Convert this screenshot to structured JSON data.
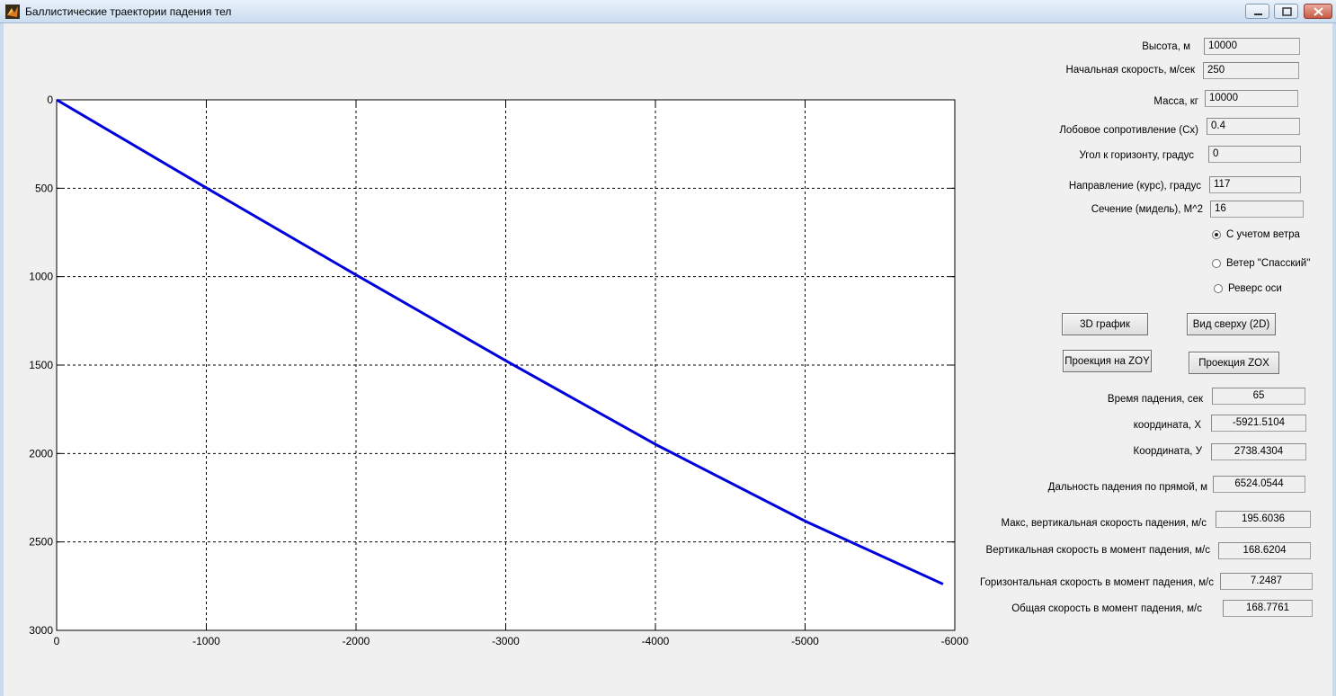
{
  "window": {
    "title": "Баллистические траектории падения тел"
  },
  "params": {
    "height_label": "Высота, м",
    "height_value": "10000",
    "speed_label": "Начальная скорость, м/сек",
    "speed_value": "250",
    "mass_label": "Масса, кг",
    "mass_value": "10000",
    "drag_label": "Лобовое сопротивление (Cx)",
    "drag_value": "0.4",
    "angle_label": "Угол к горизонту, градус",
    "angle_value": "0",
    "course_label": "Направление  (курс), градус",
    "course_value": "117",
    "section_label": "Сечение (мидель), М^2",
    "section_value": "16"
  },
  "options": {
    "wind_label": "С учетом ветра",
    "wind_selected": true,
    "spassky_label": "Ветер \"Спасский\"",
    "spassky_selected": false,
    "reverse_label": "Реверс оси",
    "reverse_selected": false
  },
  "buttons": {
    "graph3d": "3D график",
    "topview": "Вид сверху (2D)",
    "zoy": "Проекция на ZOY",
    "zox": "Проекция ZOX"
  },
  "results": {
    "time_label": "Время падения, сек",
    "time_value": "65",
    "x_label": "координата, X",
    "x_value": "-5921.5104",
    "y_label": "Координата, У",
    "y_value": "2738.4304",
    "range_label": "Дальность падения по прямой, м",
    "range_value": "6524.0544",
    "maxv_label": "Макс,  вертикальная скорость падения, м/с",
    "maxv_value": "195.6036",
    "vertv_label": "Вертикальная  скорость в момент падения, м/с",
    "vertv_value": "168.6204",
    "horv_label": "Горизонтальная скорость в момент падения, м/с",
    "horv_value": "7.2487",
    "totv_label": "Общая скорость в момент падения, м/с",
    "totv_value": "168.7761"
  },
  "chart_data": {
    "type": "line",
    "title": "",
    "xlabel": "",
    "ylabel": "",
    "xlim": [
      0,
      -6000
    ],
    "ylim": [
      0,
      3000
    ],
    "x_reversed": true,
    "y_reversed": true,
    "grid": true,
    "xticks": [
      "0",
      "-1000",
      "-2000",
      "-3000",
      "-4000",
      "-5000",
      "-6000"
    ],
    "yticks": [
      "0",
      "500",
      "1000",
      "1500",
      "2000",
      "2500",
      "3000"
    ],
    "series": [
      {
        "color": "#0000dd",
        "x": [
          0,
          -1000,
          -2000,
          -3000,
          -4000,
          -5000,
          -5921.5104
        ],
        "y": [
          0,
          498,
          990,
          1475,
          1948,
          2382,
          2738.4304
        ]
      }
    ]
  }
}
